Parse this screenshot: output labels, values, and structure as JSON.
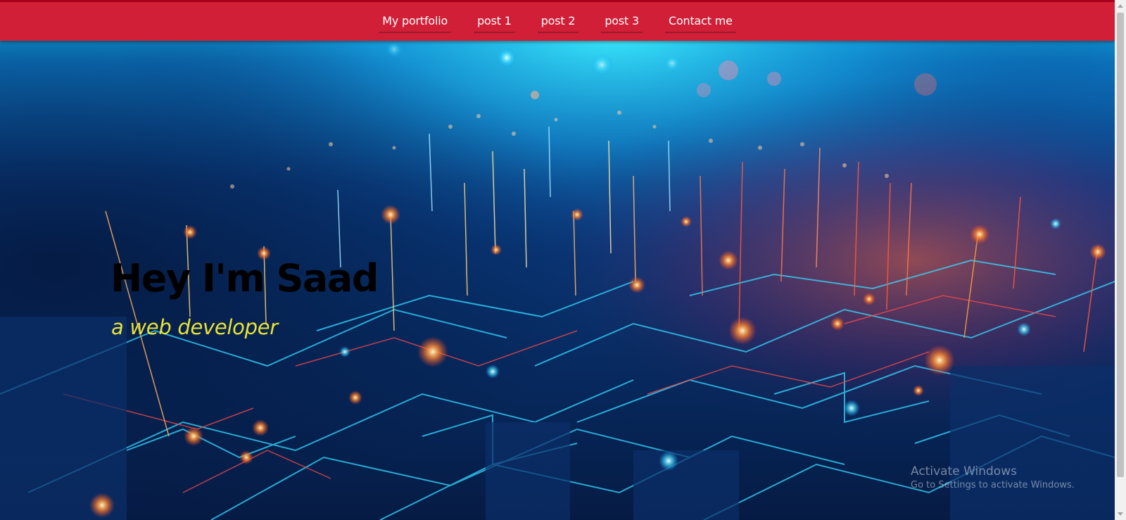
{
  "nav": {
    "items": [
      {
        "label": "My portfolio"
      },
      {
        "label": "post 1"
      },
      {
        "label": "post 2"
      },
      {
        "label": "post 3"
      },
      {
        "label": "Contact me"
      }
    ],
    "bar_color": "#d11f37"
  },
  "hero": {
    "title": "Hey I'm Saad",
    "subtitle": "a web developer",
    "background_image": "futuristic-circuit-city-image",
    "title_color": "#000000",
    "subtitle_color": "#e8e236"
  },
  "watermark": {
    "title": "Activate Windows",
    "subtitle": "Go to Settings to activate Windows."
  },
  "scrollbar": {
    "up_icon": "scroll-up-arrow-icon",
    "down_icon": "scroll-down-arrow-icon"
  }
}
